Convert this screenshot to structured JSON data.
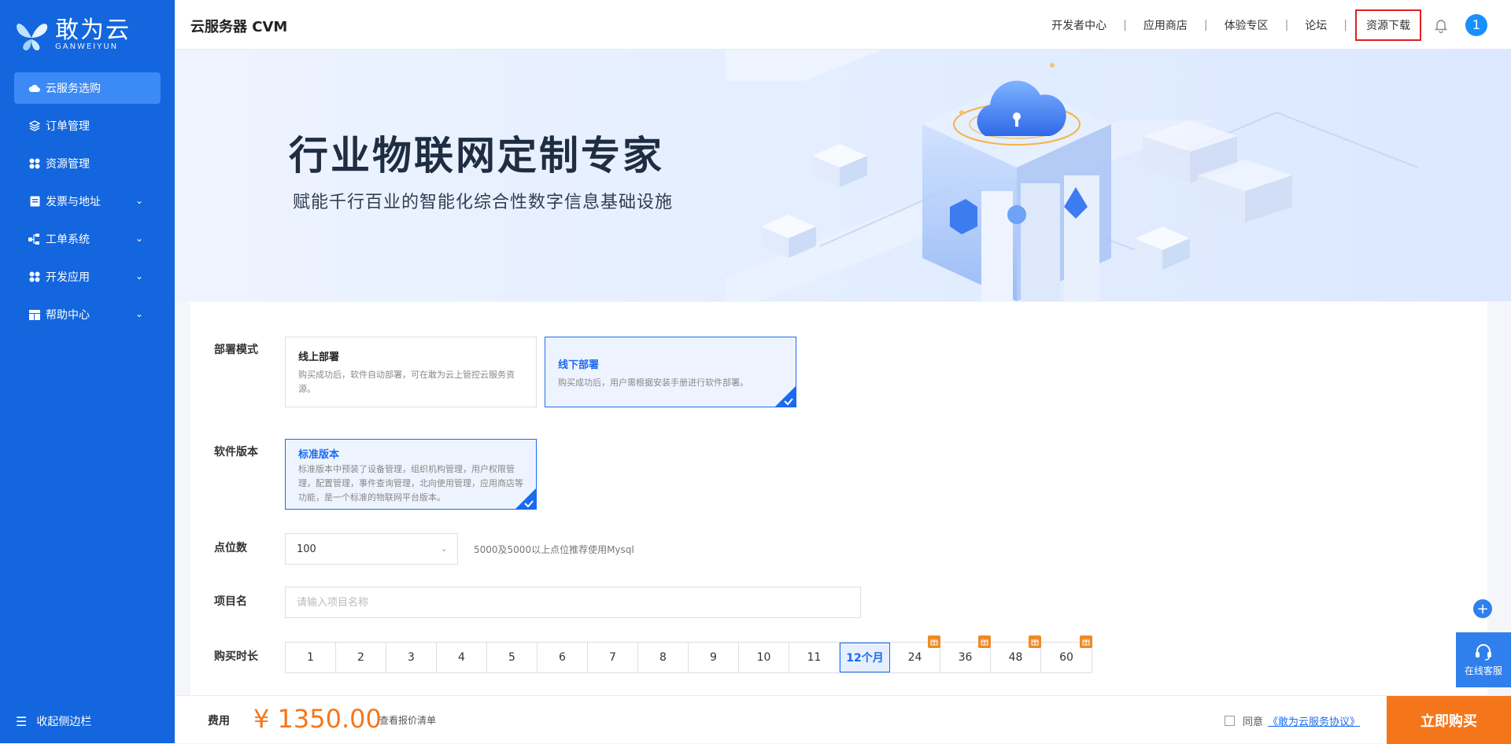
{
  "brand": {
    "name_cn": "敢为云",
    "name_en": "GANWEIYUN"
  },
  "sidebar": {
    "items": [
      {
        "label": "云服务选购",
        "icon": "cloud-icon",
        "active": true,
        "expandable": false
      },
      {
        "label": "订单管理",
        "icon": "layers-icon",
        "active": false,
        "expandable": false
      },
      {
        "label": "资源管理",
        "icon": "grid-icon",
        "active": false,
        "expandable": false
      },
      {
        "label": "发票与地址",
        "icon": "invoice-icon",
        "active": false,
        "expandable": true
      },
      {
        "label": "工单系统",
        "icon": "workorder-icon",
        "active": false,
        "expandable": true
      },
      {
        "label": "开发应用",
        "icon": "apps-icon",
        "active": false,
        "expandable": true
      },
      {
        "label": "帮助中心",
        "icon": "help-icon",
        "active": false,
        "expandable": true
      }
    ],
    "collapse_label": "收起侧边栏"
  },
  "header": {
    "title": "云服务器 CVM",
    "links": [
      "开发者中心",
      "应用商店",
      "体验专区",
      "论坛"
    ],
    "highlight_link": "资源下载",
    "avatar_text": "1"
  },
  "banner": {
    "title": "行业物联网定制专家",
    "subtitle": "赋能千行百业的智能化综合性数字信息基础设施"
  },
  "form": {
    "deploy": {
      "label": "部署模式",
      "options": [
        {
          "title": "线上部署",
          "desc": "购买成功后，软件自动部署，可在敢为云上管控云服务资源。",
          "selected": false
        },
        {
          "title": "线下部署",
          "desc": "购买成功后，用户需根据安装手册进行软件部署。",
          "selected": true
        }
      ]
    },
    "version": {
      "label": "软件版本",
      "title": "标准版本",
      "desc": "标准版本中预装了设备管理，组织机构管理，用户权限管理，配置管理，事件查询管理，北向使用管理，应用商店等功能，是一个标准的物联网平台版本。"
    },
    "points": {
      "label": "点位数",
      "value": "100",
      "hint": "5000及5000以上点位推荐使用Mysql"
    },
    "project": {
      "label": "项目名",
      "placeholder": "请输入项目名称",
      "value": ""
    },
    "duration": {
      "label": "购买时长",
      "options": [
        "1",
        "2",
        "3",
        "4",
        "5",
        "6",
        "7",
        "8",
        "9",
        "10",
        "11",
        "12个月",
        "24",
        "36",
        "48",
        "60"
      ],
      "selected": "12个月",
      "gift_options": [
        "24",
        "36",
        "48",
        "60"
      ]
    }
  },
  "floating": {
    "service_label": "在线客服"
  },
  "footer": {
    "fee_label": "费用",
    "price": "¥ 1350.00",
    "quote_link": "查看报价清单",
    "agree_label": "同意",
    "agreement_link": "《敢为云服务协议》",
    "buy_label": "立即购买"
  },
  "colors": {
    "sidebar": "#1366de",
    "primary": "#1a6bef",
    "accent": "#f5761a"
  }
}
